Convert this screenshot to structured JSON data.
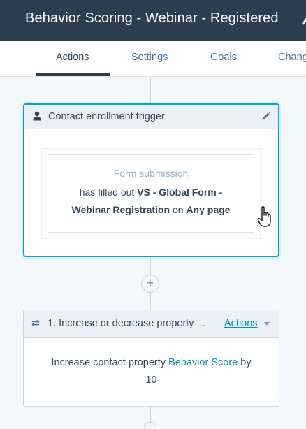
{
  "header": {
    "title": "Behavior Scoring - Webinar - Registered"
  },
  "tabs": [
    {
      "label": "Actions",
      "active": true
    },
    {
      "label": "Settings",
      "active": false
    },
    {
      "label": "Goals",
      "active": false
    },
    {
      "label": "Chang",
      "active": false
    }
  ],
  "trigger_card": {
    "title": "Contact enrollment trigger",
    "icon": "person-icon",
    "edit_icon": "pencil-icon",
    "filter": {
      "type": "Form submission",
      "prefix": "has filled out",
      "form_name_part1": "VS - Global Form -",
      "form_name_part2": "Webinar Registration",
      "connector": "on",
      "page": "Any page"
    }
  },
  "connector": {
    "add_symbol": "+"
  },
  "action_card": {
    "icon": "arrows-icon",
    "icon_glyph": "⇄",
    "title": "1. Increase or decrease property ...",
    "actions_label": "Actions",
    "body_prefix": "Increase contact property",
    "property_name": "Behavior Score",
    "body_suffix": "by",
    "amount": "10"
  },
  "colors": {
    "header_bg": "#2d3e50",
    "accent": "#00a4bd",
    "link": "#0091ae",
    "text": "#33475b"
  }
}
